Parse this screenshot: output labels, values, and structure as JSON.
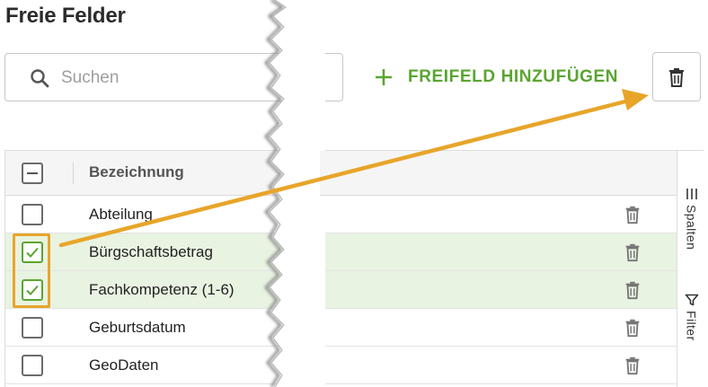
{
  "page": {
    "title": "Freie Felder"
  },
  "search": {
    "placeholder": "Suchen",
    "value": ""
  },
  "toolbar": {
    "add_label": "FREIFELD HINZUFÜGEN",
    "delete_icon": "trash-icon"
  },
  "grid": {
    "column_header": "Bezeichnung",
    "rows": [
      {
        "label": "Abteilung",
        "checked": false
      },
      {
        "label": "Bürgschaftsbetrag",
        "checked": true
      },
      {
        "label": "Fachkompetenz (1-6)",
        "checked": true
      },
      {
        "label": "Geburtsdatum",
        "checked": false
      },
      {
        "label": "GeoDaten",
        "checked": false
      }
    ]
  },
  "side_panel": {
    "columns_label": "Spalten",
    "filter_label": "Filter"
  },
  "colors": {
    "accent": "#5aa531",
    "selected_row": "#e8f3e1",
    "annotation": "#e8a52a"
  }
}
